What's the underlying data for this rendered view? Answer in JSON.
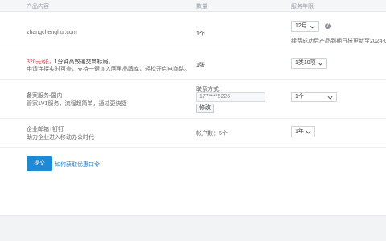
{
  "header": {
    "col_product": "产品内容",
    "col_qty": "数量",
    "col_term": "服务年限"
  },
  "rows": {
    "domain": {
      "name": "zhangchenghui.com",
      "qty": "1个",
      "term": "12月",
      "help": "?",
      "note": "续费成功后产品到期日将更新至2024-0"
    },
    "trademark": {
      "price": "320元/张，",
      "desc1": "1分钟高效递交商标局。",
      "desc2": "申请连接实时可查，支持一键加入阿里品牌库，轻松开启电商路。",
      "qty": "1张",
      "term": "1类10项"
    },
    "beian": {
      "title": "备案服务-国内",
      "desc": "管家1V1服务，流程超简单，通过更快捷",
      "contact_label": "联系方式:",
      "contact_value": "177****5226",
      "modify": "修改",
      "term": "1个"
    },
    "mail": {
      "title": "企业邮箱+钉钉",
      "desc": "助力企业进入移动办公时代",
      "qty": "帐户数：5个",
      "term": "1年"
    }
  },
  "actions": {
    "submit": "提交",
    "coupon_link": "如何获取优惠口令"
  }
}
